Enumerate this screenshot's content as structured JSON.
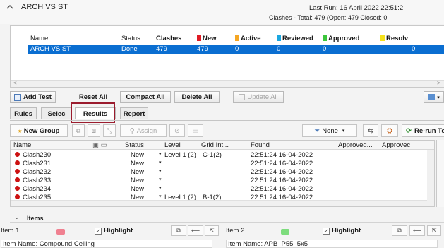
{
  "header": {
    "title": "ARCH VS ST",
    "last_run": "Last Run:  16 April 2022 22:51:2",
    "clashes_summary": "Clashes - Total:  479  (Open:  479  Closed:  0"
  },
  "tests_table": {
    "columns": [
      "Name",
      "Status",
      "Clashes",
      "New",
      "Active",
      "Reviewed",
      "Approved",
      "Resolv"
    ],
    "column_colors": {
      "New": "#e01b24",
      "Active": "#f5a623",
      "Reviewed": "#1ba7e0",
      "Approved": "#3cc63c",
      "Resolved": "#f5e21b"
    },
    "row": {
      "name": "ARCH VS ST",
      "status": "Done",
      "clashes": "479",
      "new": "479",
      "active": "0",
      "reviewed": "0",
      "approved": "0",
      "resolved": "0"
    }
  },
  "test_buttons": {
    "add_test": "Add Test",
    "reset_all": "Reset All",
    "compact_all": "Compact All",
    "delete_all": "Delete All",
    "update_all": "Update All"
  },
  "tabs": [
    "Rules",
    "Selec",
    "Results",
    "Report"
  ],
  "results_toolbar": {
    "new_group": "New Group",
    "assign": "Assign",
    "none": "None",
    "rerun": "Re-run Test"
  },
  "results_grid": {
    "columns": [
      "Name",
      "Status",
      "Level",
      "Grid Int...",
      "Found",
      "Approved...",
      "Approvec"
    ],
    "rows": [
      {
        "name": "Clash230",
        "status": "New",
        "level": "Level 1 (2)",
        "grid": "C-1(2)",
        "found": "22:51:24 16-04-2022"
      },
      {
        "name": "Clash231",
        "status": "New",
        "level": "",
        "grid": "",
        "found": "22:51:24 16-04-2022"
      },
      {
        "name": "Clash232",
        "status": "New",
        "level": "",
        "grid": "",
        "found": "22:51:24 16-04-2022"
      },
      {
        "name": "Clash233",
        "status": "New",
        "level": "",
        "grid": "",
        "found": "22:51:24 16-04-2022"
      },
      {
        "name": "Clash234",
        "status": "New",
        "level": "",
        "grid": "",
        "found": "22:51:24 16-04-2022"
      },
      {
        "name": "Clash235",
        "status": "New",
        "level": "Level 1 (2)",
        "grid": "B-1(2)",
        "found": "22:51:24 16-04-2022"
      }
    ]
  },
  "items": {
    "title": "Items",
    "item1_label": "Item 1",
    "item1_color": "#f08090",
    "item2_label": "Item 2",
    "item2_color": "#7ddc7d",
    "highlight": "Highlight",
    "item1_name": "Item Name: Compound Ceiling",
    "item2_name": "Item Name: APB_P55_5x5"
  }
}
